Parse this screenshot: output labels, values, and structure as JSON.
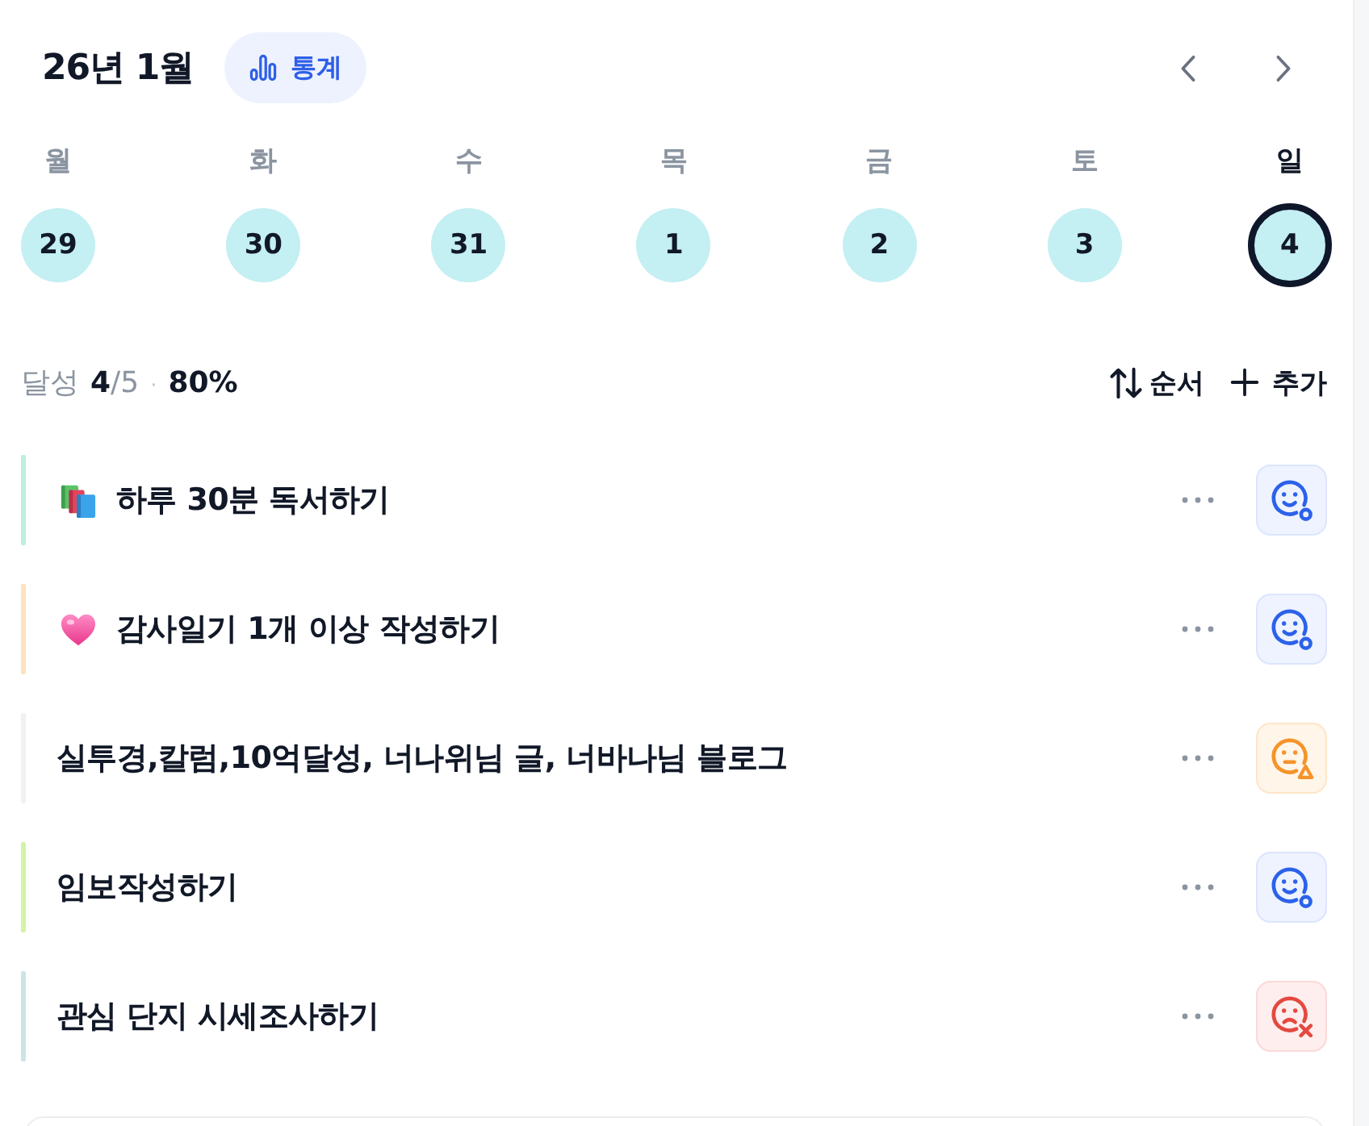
{
  "header": {
    "title": "26년 1월",
    "stats_button": {
      "label": "통계"
    }
  },
  "week": {
    "days": [
      {
        "weekday": "월",
        "date": "29",
        "selected": false
      },
      {
        "weekday": "화",
        "date": "30",
        "selected": false
      },
      {
        "weekday": "수",
        "date": "31",
        "selected": false
      },
      {
        "weekday": "목",
        "date": "1",
        "selected": false
      },
      {
        "weekday": "금",
        "date": "2",
        "selected": false
      },
      {
        "weekday": "토",
        "date": "3",
        "selected": false
      },
      {
        "weekday": "일",
        "date": "4",
        "selected": true
      }
    ]
  },
  "summary": {
    "label": "달성",
    "done": "4",
    "total": "/5",
    "separator": "·",
    "percent": "80%"
  },
  "actions": [
    {
      "kind": "sort",
      "label": "순서"
    },
    {
      "kind": "add",
      "label": "추가"
    }
  ],
  "habits": [
    {
      "title": "하루 30분 독서하기",
      "emoji": {
        "kind": "books"
      },
      "color": "#bdf0dc",
      "kind": "success"
    },
    {
      "title": "감사일기 1개 이상 작성하기",
      "emoji": {
        "kind": "heart"
      },
      "color": "#fde2bd",
      "kind": "success"
    },
    {
      "title": "실투경,칼럼,10억달성, 너나위님 글, 너바나님 블로그",
      "color": "#f0f1f3",
      "kind": "warning"
    },
    {
      "title": "임보작성하기",
      "color": "#d4f3a6",
      "kind": "success"
    },
    {
      "title": "관심 단지 시세조사하기",
      "color": "#cde4e4",
      "kind": "fail"
    }
  ]
}
